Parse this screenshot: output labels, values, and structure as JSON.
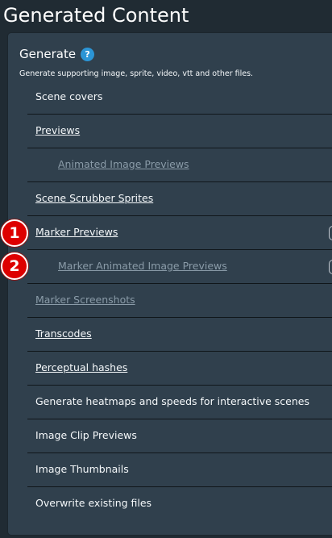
{
  "page": {
    "title": "Generated Content"
  },
  "generate": {
    "title": "Generate",
    "help_icon": "?",
    "description": "Generate supporting image, sprite, video, vtt and other files."
  },
  "options": [
    {
      "label": "Scene covers",
      "style": "plain",
      "indent": false
    },
    {
      "label": "Previews",
      "style": "link",
      "indent": false
    },
    {
      "label": "Animated Image Previews",
      "style": "disabled-link",
      "indent": true
    },
    {
      "label": "Scene Scrubber Sprites",
      "style": "link",
      "indent": false
    },
    {
      "label": "Marker Previews",
      "style": "link",
      "indent": false
    },
    {
      "label": "Marker Animated Image Previews",
      "style": "disabled-link",
      "indent": true
    },
    {
      "label": "Marker Screenshots",
      "style": "disabled-link",
      "indent": false
    },
    {
      "label": "Transcodes",
      "style": "link",
      "indent": false
    },
    {
      "label": "Perceptual hashes",
      "style": "link",
      "indent": false
    },
    {
      "label": "Generate heatmaps and speeds for interactive scenes",
      "style": "plain",
      "indent": false
    },
    {
      "label": "Image Clip Previews",
      "style": "plain",
      "indent": false
    },
    {
      "label": "Image Thumbnails",
      "style": "plain",
      "indent": false
    },
    {
      "label": "Overwrite existing files",
      "style": "plain",
      "indent": false
    }
  ],
  "badges": [
    "1",
    "2"
  ]
}
